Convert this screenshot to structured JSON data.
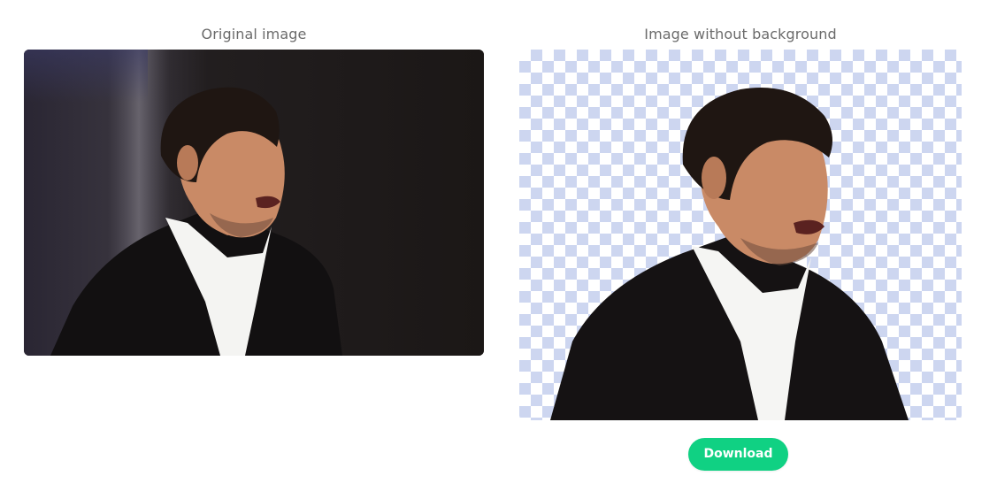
{
  "original": {
    "title": "Original image"
  },
  "result": {
    "title": "Image without background"
  },
  "actions": {
    "download_label": "Download"
  },
  "colors": {
    "accent": "#10d183",
    "title_text": "#6b6b6b",
    "checker": "#cdd6f0",
    "dark_bg": "#1e1a19"
  }
}
